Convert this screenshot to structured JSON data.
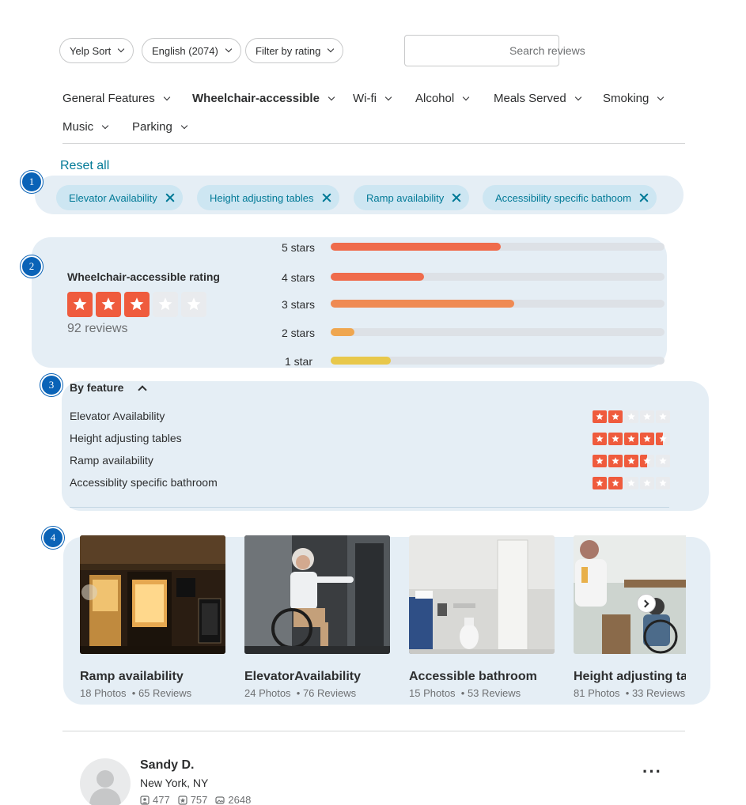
{
  "filters": {
    "sort": "Yelp Sort",
    "language": "English (2074)",
    "rating_filter": "Filter by rating",
    "search_placeholder": "Search reviews"
  },
  "tabs": [
    {
      "label": "General Features",
      "active": false
    },
    {
      "label": "Wheelchair-accessible",
      "active": true
    },
    {
      "label": "Wi-fi",
      "active": false
    },
    {
      "label": "Alcohol",
      "active": false
    },
    {
      "label": "Meals Served",
      "active": false
    },
    {
      "label": "Smoking",
      "active": false
    },
    {
      "label": "Music",
      "active": false
    },
    {
      "label": "Parking",
      "active": false
    }
  ],
  "steps": [
    "1",
    "2",
    "3",
    "4"
  ],
  "selected_filters": {
    "reset_label": "Reset all",
    "chips": [
      "Elevator Availability",
      "Height adjusting tables",
      "Ramp availability",
      "Accessibility specific bathoom"
    ]
  },
  "rating": {
    "title": "Wheelchair-accessible rating",
    "stars": 3,
    "review_count": "92 reviews",
    "distribution": [
      {
        "label": "5 stars",
        "fraction": 0.51,
        "color": "#ef6b4b"
      },
      {
        "label": "4 stars",
        "fraction": 0.28,
        "color": "#ef6b4b"
      },
      {
        "label": "3 stars",
        "fraction": 0.55,
        "color": "#ef8a53"
      },
      {
        "label": "2 stars",
        "fraction": 0.07,
        "color": "#efa64f"
      },
      {
        "label": "1 star",
        "fraction": 0.18,
        "color": "#e8c84b"
      }
    ]
  },
  "by_feature": {
    "title": "By feature",
    "items": [
      {
        "label": "Elevator Availability",
        "rating": 2
      },
      {
        "label": "Height adjusting tables",
        "rating": 4.5
      },
      {
        "label": "Ramp availability",
        "rating": 3.5
      },
      {
        "label": "Accessiblity specific bathroom",
        "rating": 2
      }
    ]
  },
  "photos": [
    {
      "title": "Ramp availability",
      "photos": "18 Photos",
      "reviews": "65 Reviews",
      "image": "restaurant-entrance-night"
    },
    {
      "title": "ElevatorAvailability",
      "photos": "24 Photos",
      "reviews": "76 Reviews",
      "image": "woman-wheelchair-elevator"
    },
    {
      "title": "Accessible bathroom",
      "photos": "15 Photos",
      "reviews": "53 Reviews",
      "image": "accessible-bathroom"
    },
    {
      "title": "Height adjusting tables",
      "photos": "81 Photos",
      "reviews": "33 Reviews",
      "image": "men-at-table-wheelchair"
    }
  ],
  "review": {
    "name": "Sandy D.",
    "location": "New York, NY",
    "friends": "477",
    "reviews": "757",
    "photos": "2648"
  },
  "colors": {
    "star_active": "#ef5b3d",
    "star_inactive": "#e9ebee",
    "panel_bg": "#e5eef5",
    "chip_bg": "#cde6f2",
    "chip_text": "#027a97",
    "badge": "#0a63b7"
  }
}
